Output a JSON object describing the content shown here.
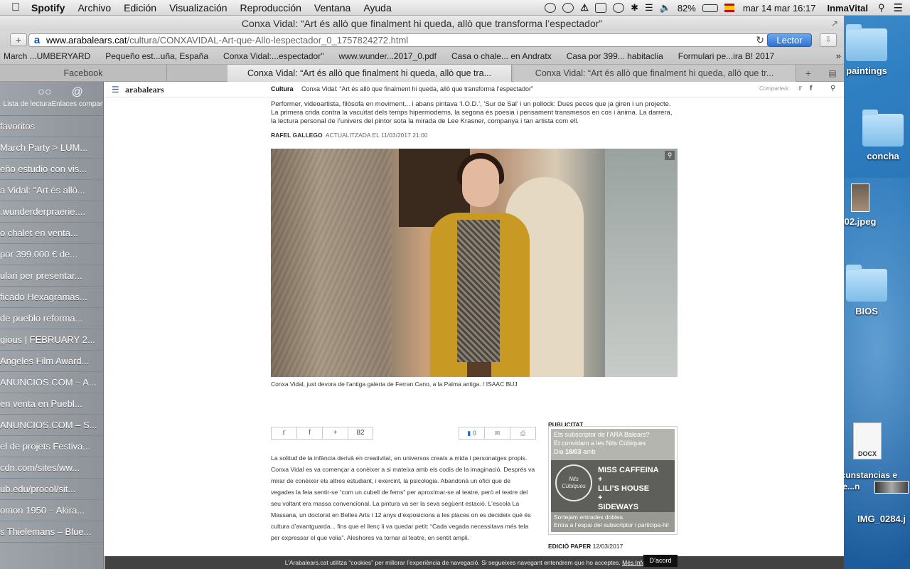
{
  "menubar": {
    "apple_icon": "apple-logo",
    "app": "Spotify",
    "items": [
      "Archivo",
      "Edición",
      "Visualización",
      "Reproducción",
      "Ventana",
      "Ayuda"
    ],
    "battery": "82%",
    "datetime": "mar 14 mar  16:17",
    "user": "InmaVital"
  },
  "window": {
    "title": "Conxa Vidal: “Art és allò que finalment hi queda, allò que transforma l’espectador”",
    "url_domain": "www.arabalears.cat",
    "url_path": "/cultura/CONXAVIDAL-Art-que-Allo-lespectador_0_1757824272.html",
    "reader_label": "Lector",
    "add_label": "+",
    "bookmarks": [
      "March ...UMBERYARD",
      "Pequeño est...uña, España",
      "Conxa Vidal:...espectador\"",
      "www.wunder...2017_0.pdf",
      "Casa o chale... en Andratx",
      "Casa por 399... habitaclia",
      "Formulari pe...ira B! 2017"
    ],
    "tabs": [
      "Facebook",
      "Conxa Vidal: “Art és allò que finalment hi queda, allò que tra...",
      "Conxa Vidal: “Art és allò que finalment hi queda, allò que tr..."
    ]
  },
  "sidebar": {
    "reading_list": "Lista de lectura",
    "shared_links": "Enlaces compartidos",
    "items": [
      "favoritos",
      "March Party > LUM...",
      "eño estudio con vis...",
      "a Vidal: “Art és allò...",
      ".wunderderpraerie....",
      "o chalet en venta...",
      "por 399.000 € de...",
      "ulari per presentar...",
      "ficado Hexagramas...",
      "de pueblo reforma...",
      "gious | FEBRUARY 2...",
      "Angeles Film Award...",
      "ANUNCIOS.COM – A...",
      "en venta en Puebl...",
      "ANUNCIOS.COM – S...",
      "el de projets Festiva...",
      "cdn.com/sites/ww...",
      "ub.edu/procol/sit...",
      "omon 1950 – Akira...",
      "s Thielemans – Blue..."
    ]
  },
  "site": {
    "logo": "arabalears",
    "section": "Cultura",
    "header_title": "Conxa Vidal: “Art és allò que finalment hi queda, allò que transforma l’espectador”",
    "share_label": "Comparteix",
    "lead": "Performer, videoartista, filòsofa en moviment... i abans pintava ‘I.O.D.’, ‘Sur de Sal’ i un pollock: Dues peces que ja giren i un projecte. La primera crida contra la vacuïtat dels temps hipermoderns, la segona és poesia i pensament transmesos en cos i ànima. La darrera, la lectura personal de l’univers del pintor sota la mirada de Lee Krasner, companya i tan artista com ell.",
    "author": "RAFEL GALLEGO",
    "updated": "ACTUALITZADA EL 11/03/2017 21:00",
    "caption": "Conxa Vidal, just devora de l’antiga galeria de Ferran Cano, a la Palma antiga. / ISAAC BUJ",
    "share_count": "82",
    "comments_count": "0",
    "body": "La solitud de la infància derivà en creativitat, en universos creats a mida i personatges propis. Conxa Vidal es va començar a conèixer a si mateixa amb els codis de la imaginació. Després va mirar de conèixer els altres estudiant, i exercint, la psicologia. Abandonà un ofici que de vegades la feia sentir-se “com un cubell de fems” per aproximar-se al teatre, però el teatre del seu voltant era massa convencional. La pintura va ser la seva següent estació. L’escola La Massana, un doctorat en Belles Arts i 12 anys d’exposicions a les places on es decideix què és cultura d’avantguarda... fins que el llenç li va quedar petit: “Cada vegada necessitava més tela per expressar el que volia”. Aleshores va tornar al teatre, en sentit ampli.",
    "publicitat": "PUBLICITAT",
    "ad": {
      "line1": "Ets subscriptor de l’ARA Balears?",
      "line2": "Et convidam a les Nits Cúbiques",
      "line3_pre": "Dia",
      "line3_day": "18/03",
      "line3_post": "amb",
      "logo": "Nits Cúbiques",
      "bands": "MISS CAFFEINA\n+\nLILI’S HOUSE\n+\nSIDEWAYS",
      "bottom1": "Sortejam entrades dobles.",
      "bottom2": "Entra a l’espai del subscriptor i participa-hi!"
    },
    "edicio_label": "EDICIÓ PAPER",
    "edicio_date": "12/03/2017",
    "cookie_text": "L’Arabalears.cat utilitza “cookies” per millorar l’experiència de navegació. Si segueixes navegant entendrem que ho acceptes.",
    "cookie_more": "Més Informació",
    "cookie_ok": "D’acord"
  },
  "desktop": {
    "items": [
      "paintings",
      "concha",
      "02.jpeg",
      "BIOS",
      "DOCX",
      "rcunstancias e pe...n",
      "IMG_0284.j"
    ]
  }
}
